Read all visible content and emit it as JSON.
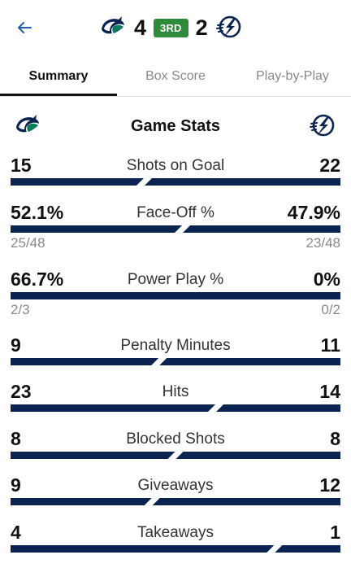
{
  "header": {
    "back_icon": "arrow-left-icon",
    "home_score": "4",
    "away_score": "2",
    "period": "3RD",
    "home_logo": "canucks-orca-logo",
    "away_logo": "lightning-bolt-logo"
  },
  "tabs": [
    {
      "label": "Summary",
      "active": true
    },
    {
      "label": "Box Score",
      "active": false
    },
    {
      "label": "Play-by-Play",
      "active": false
    }
  ],
  "game_stats": {
    "title": "Game Stats",
    "stats": [
      {
        "label": "Shots on Goal",
        "home": "15",
        "away": "22",
        "home_share": 0.405
      },
      {
        "label": "Face-Off %",
        "home": "52.1%",
        "away": "47.9%",
        "home_sub": "25/48",
        "away_sub": "23/48",
        "home_share": 0.521
      },
      {
        "label": "Power Play %",
        "home": "66.7%",
        "away": "0%",
        "home_sub": "2/3",
        "away_sub": "0/2",
        "home_share": 1.0
      },
      {
        "label": "Penalty Minutes",
        "home": "9",
        "away": "11",
        "home_share": 0.45
      },
      {
        "label": "Hits",
        "home": "23",
        "away": "14",
        "home_share": 0.622
      },
      {
        "label": "Blocked Shots",
        "home": "8",
        "away": "8",
        "home_share": 0.5
      },
      {
        "label": "Giveaways",
        "home": "9",
        "away": "12",
        "home_share": 0.429
      },
      {
        "label": "Takeaways",
        "home": "4",
        "away": "1",
        "home_share": 0.8
      }
    ]
  },
  "colors": {
    "bar": "#0b2350",
    "period_badge": "#2e8b3a",
    "accent_blue": "#1f5fae"
  }
}
